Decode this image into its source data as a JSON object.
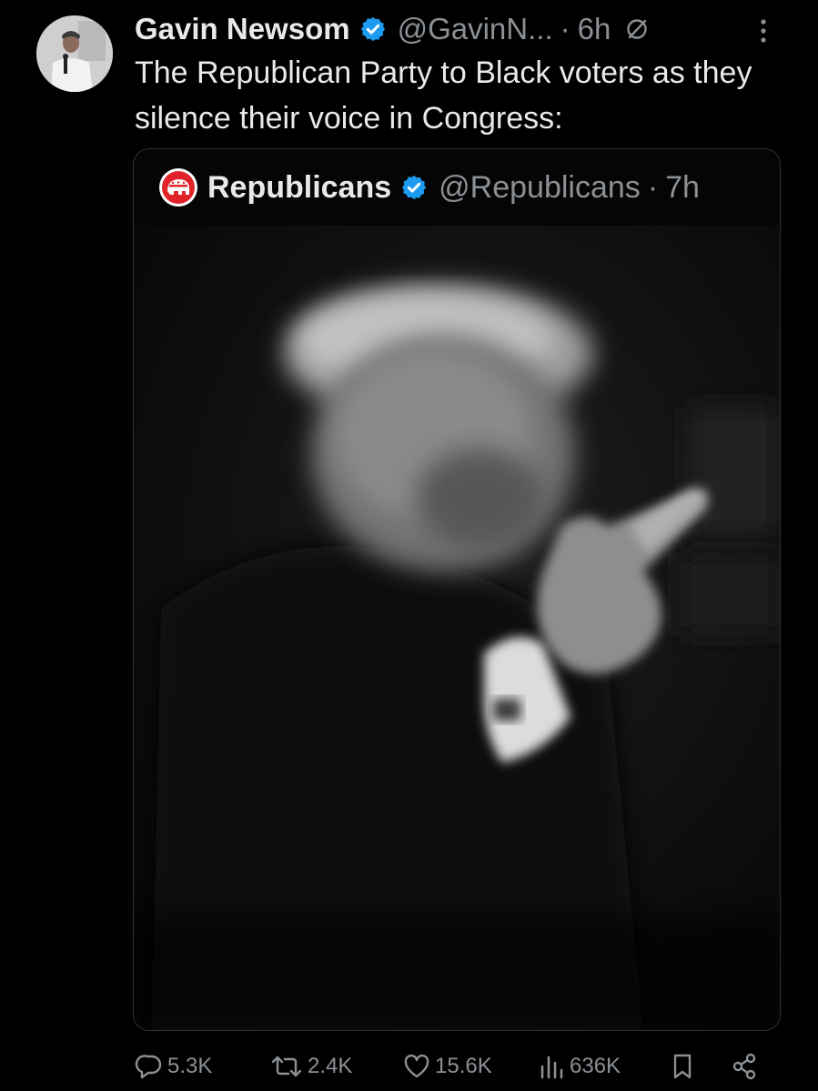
{
  "tweet": {
    "author_name": "Gavin Newsom",
    "handle": "@GavinN...",
    "separator": "·",
    "time": "6h",
    "text": "The Republican Party to Black voters as they silence their voice in Congress:",
    "avatar_icon": "avatar-photo",
    "verified_icon": "verified-badge-icon",
    "menu_icon": "more-vertical-icon"
  },
  "quote": {
    "author_name": "Republicans",
    "handle": "@Republicans",
    "separator": "·",
    "time": "7h",
    "avatar_icon": "gop-elephant-logo",
    "verified_icon": "verified-badge-icon"
  },
  "actions": {
    "replies": "5.3K",
    "reposts": "2.4K",
    "likes": "15.6K",
    "views": "636K",
    "bookmark_icon": "bookmark-icon",
    "share_icon": "share-icon"
  },
  "colors": {
    "background": "#000000",
    "text_primary": "#e7e9ea",
    "text_secondary": "#8b9095",
    "verified_blue": "#1d9bf0",
    "border": "#2f3336",
    "gop_red": "#e0242a"
  }
}
